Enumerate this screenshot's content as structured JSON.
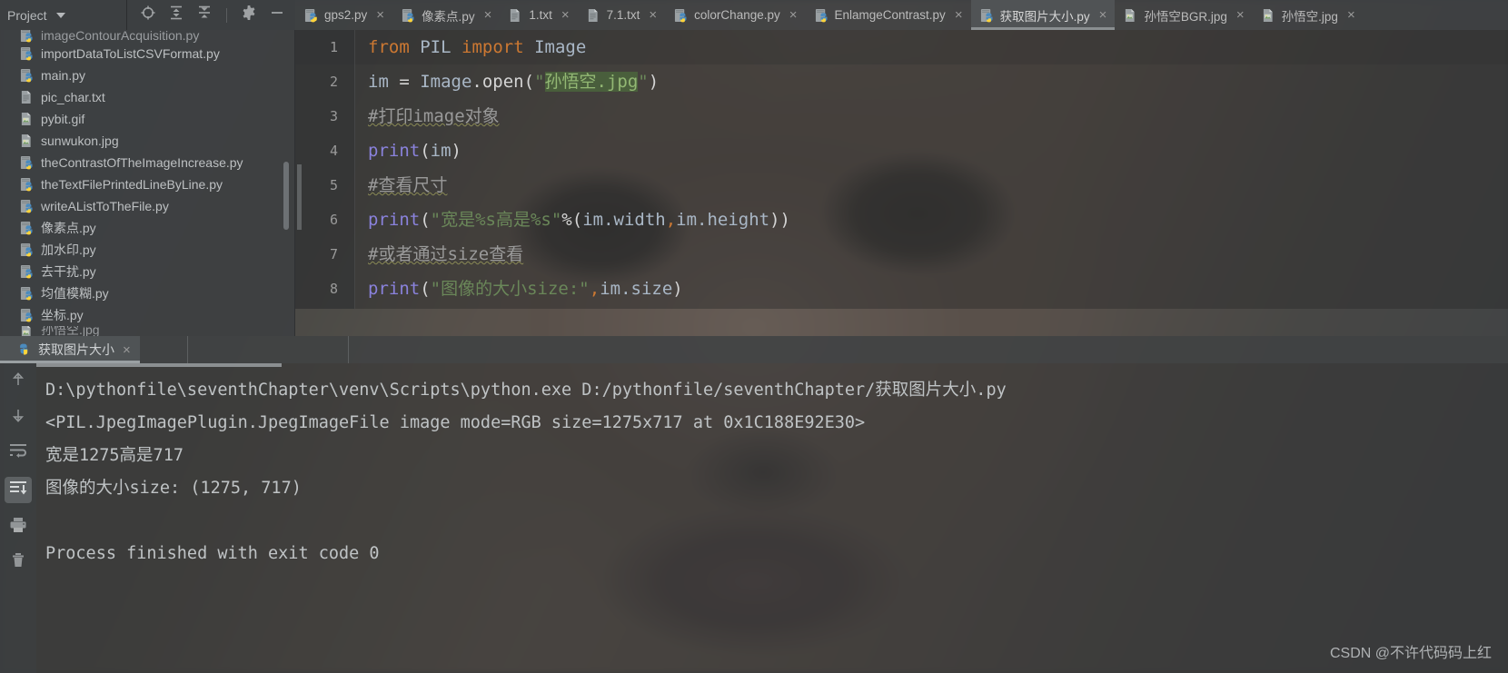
{
  "window": {
    "project_panel": {
      "title": "Project",
      "dropdown_icon": "caret-down-icon",
      "tools": [
        "locate-icon",
        "expand-all-icon",
        "collapse-all-icon",
        "settings-gear-icon",
        "hide-icon"
      ]
    }
  },
  "project_tree": {
    "items": [
      {
        "name": "imageContourAcquisition.py",
        "icon": "python-file-icon",
        "clipped": true
      },
      {
        "name": "importDataToListCSVFormat.py",
        "icon": "python-file-icon"
      },
      {
        "name": "main.py",
        "icon": "python-file-icon"
      },
      {
        "name": "pic_char.txt",
        "icon": "text-file-icon"
      },
      {
        "name": "pybit.gif",
        "icon": "image-file-icon"
      },
      {
        "name": "sunwukon.jpg",
        "icon": "image-file-icon"
      },
      {
        "name": "theContrastOfTheImageIncrease.py",
        "icon": "python-file-icon"
      },
      {
        "name": "theTextFilePrintedLineByLine.py",
        "icon": "python-file-icon"
      },
      {
        "name": "writeAListToTheFile.py",
        "icon": "python-file-icon"
      },
      {
        "name": "像素点.py",
        "icon": "python-file-icon"
      },
      {
        "name": "加水印.py",
        "icon": "python-file-icon"
      },
      {
        "name": "去干扰.py",
        "icon": "python-file-icon"
      },
      {
        "name": "均值模糊.py",
        "icon": "python-file-icon"
      },
      {
        "name": "坐标.py",
        "icon": "python-file-icon"
      },
      {
        "name": "孙悟空.jpg",
        "icon": "image-file-icon",
        "clipped": true
      }
    ]
  },
  "editor_tabs": [
    {
      "label": "gps2.py",
      "icon": "python-file-icon",
      "active": false,
      "close": "×"
    },
    {
      "label": "像素点.py",
      "icon": "python-file-icon",
      "active": false,
      "close": "×"
    },
    {
      "label": "1.txt",
      "icon": "text-file-icon",
      "active": false,
      "close": "×"
    },
    {
      "label": "7.1.txt",
      "icon": "text-file-icon",
      "active": false,
      "close": "×"
    },
    {
      "label": "colorChange.py",
      "icon": "python-file-icon",
      "active": false,
      "close": "×"
    },
    {
      "label": "EnlamgeContrast.py",
      "icon": "python-file-icon",
      "active": false,
      "close": "×"
    },
    {
      "label": "获取图片大小.py",
      "icon": "python-file-icon",
      "active": true,
      "close": "×"
    },
    {
      "label": "孙悟空BGR.jpg",
      "icon": "image-file-icon",
      "active": false,
      "close": "×"
    },
    {
      "label": "孙悟空.jpg",
      "icon": "image-file-icon",
      "active": false,
      "close": "×"
    }
  ],
  "code": {
    "line_numbers": [
      "1",
      "2",
      "3",
      "4",
      "5",
      "6",
      "7",
      "8"
    ],
    "lines": [
      {
        "n": "1",
        "tokens": [
          {
            "t": "from",
            "c": "kw"
          },
          {
            "t": " ",
            "c": "plain"
          },
          {
            "t": "PIL",
            "c": "ident"
          },
          {
            "t": " ",
            "c": "plain"
          },
          {
            "t": "import",
            "c": "kw"
          },
          {
            "t": " ",
            "c": "plain"
          },
          {
            "t": "Image",
            "c": "ident"
          }
        ]
      },
      {
        "n": "2",
        "tokens": [
          {
            "t": "im",
            "c": "ident"
          },
          {
            "t": " = ",
            "c": "plain"
          },
          {
            "t": "Image",
            "c": "ident"
          },
          {
            "t": ".open(",
            "c": "plain"
          },
          {
            "t": "\"",
            "c": "str"
          },
          {
            "t": "孙悟空.jpg",
            "c": "hl-str"
          },
          {
            "t": "\"",
            "c": "str"
          },
          {
            "t": ")",
            "c": "plain"
          }
        ]
      },
      {
        "n": "3",
        "tokens": [
          {
            "t": "#打印image对象",
            "c": "comment squiggle"
          }
        ]
      },
      {
        "n": "4",
        "tokens": [
          {
            "t": "print",
            "c": "fn"
          },
          {
            "t": "(",
            "c": "plain"
          },
          {
            "t": "im",
            "c": "ident"
          },
          {
            "t": ")",
            "c": "plain"
          }
        ]
      },
      {
        "n": "5",
        "tokens": [
          {
            "t": "#查看尺寸",
            "c": "comment squiggle"
          }
        ]
      },
      {
        "n": "6",
        "tokens": [
          {
            "t": "print",
            "c": "fn"
          },
          {
            "t": "(",
            "c": "plain"
          },
          {
            "t": "\"宽是%s高是%s\"",
            "c": "str"
          },
          {
            "t": "%(",
            "c": "plain"
          },
          {
            "t": "im.width",
            "c": "ident"
          },
          {
            "t": ",",
            "c": "comma"
          },
          {
            "t": "im.height",
            "c": "ident"
          },
          {
            "t": "))",
            "c": "plain"
          }
        ]
      },
      {
        "n": "7",
        "tokens": [
          {
            "t": "#或者通过size查看",
            "c": "comment squiggle"
          }
        ]
      },
      {
        "n": "8",
        "tokens": [
          {
            "t": "print",
            "c": "fn"
          },
          {
            "t": "(",
            "c": "plain"
          },
          {
            "t": "\"图像的大小size:\"",
            "c": "str"
          },
          {
            "t": ",",
            "c": "comma"
          },
          {
            "t": "im.size",
            "c": "ident"
          },
          {
            "t": ")",
            "c": "plain"
          }
        ]
      }
    ]
  },
  "run_panel": {
    "tab": {
      "label": "获取图片大小",
      "icon": "python-run-icon",
      "close": "×"
    },
    "sidebar_icons": [
      "up-arrow-icon",
      "down-arrow-icon",
      "soft-wrap-icon",
      "scroll-to-end-icon",
      "print-icon",
      "trash-icon"
    ],
    "console_lines": [
      "D:\\pythonfile\\seventhChapter\\venv\\Scripts\\python.exe D:/pythonfile/seventhChapter/获取图片大小.py",
      "<PIL.JpegImagePlugin.JpegImageFile image mode=RGB size=1275x717 at 0x1C188E92E30>",
      "宽是1275高是717",
      "图像的大小size: (1275, 717)",
      "",
      "Process finished with exit code 0"
    ]
  },
  "watermark": "CSDN @不许代码码上红",
  "colors": {
    "background": "#3c3f41",
    "editor_bg": "#2b2b2b",
    "keyword": "#cc7832",
    "string": "#6a8759",
    "function": "#8a82dc",
    "comment": "#9a9a9a",
    "identifier": "#a9b7c6",
    "highlight_string_bg": "#4f7a3c"
  }
}
